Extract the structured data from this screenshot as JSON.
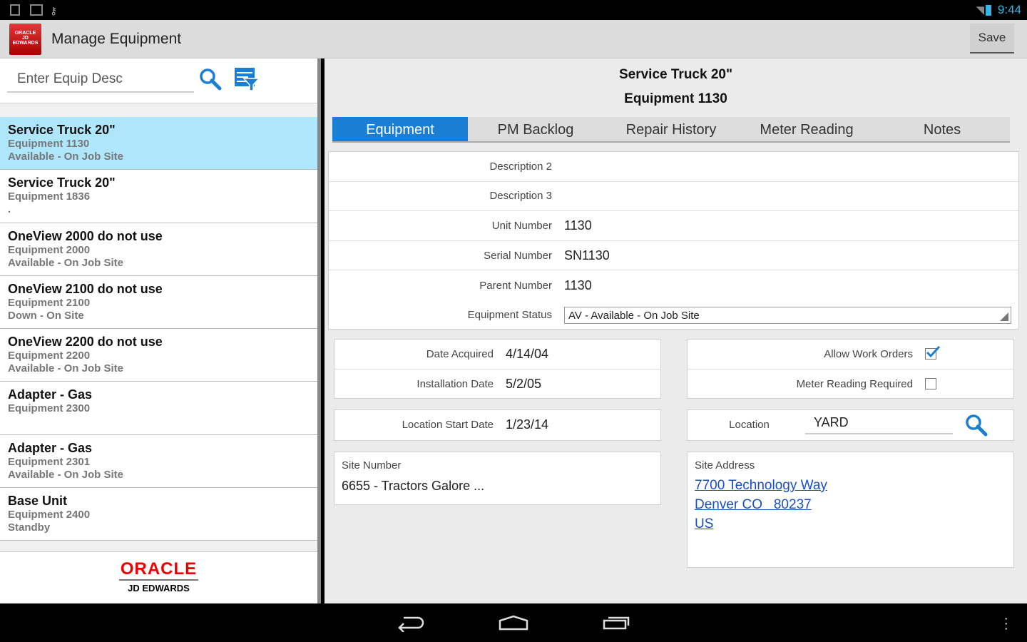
{
  "status": {
    "time": "9:44"
  },
  "app": {
    "title": "Manage Equipment",
    "save_label": "Save",
    "logo_text": "ORACLE"
  },
  "search": {
    "placeholder": "Enter Equip Desc"
  },
  "list": [
    {
      "name": "Service Truck 20\"",
      "sub1": "Equipment 1130",
      "sub2": "Available - On Job Site",
      "selected": true
    },
    {
      "name": "Service Truck 20\"",
      "sub1": "Equipment 1836",
      "sub2": "."
    },
    {
      "name": "OneView 2000 do not use",
      "sub1": "Equipment 2000",
      "sub2": "Available - On Job Site"
    },
    {
      "name": "OneView 2100 do not use",
      "sub1": "Equipment 2100",
      "sub2": "Down - On Site"
    },
    {
      "name": "OneView 2200 do not use",
      "sub1": "Equipment 2200",
      "sub2": "Available - On Job Site"
    },
    {
      "name": "Adapter - Gas",
      "sub1": "Equipment 2300",
      "sub2": ""
    },
    {
      "name": "Adapter - Gas",
      "sub1": "Equipment 2301",
      "sub2": "Available - On Job Site"
    },
    {
      "name": "Base Unit",
      "sub1": "Equipment 2400",
      "sub2": "Standby"
    }
  ],
  "footer": {
    "oracle": "ORACLE",
    "jde": "JD EDWARDS"
  },
  "detail": {
    "title": "Service Truck 20\"",
    "subtitle": "Equipment 1130",
    "tabs": [
      "Equipment",
      "PM Backlog",
      "Repair History",
      "Meter Reading",
      "Notes"
    ],
    "fields": [
      {
        "label": "Description 2",
        "value": ""
      },
      {
        "label": "Description 3",
        "value": ""
      },
      {
        "label": "Unit Number",
        "value": "1130"
      },
      {
        "label": "Serial Number",
        "value": "SN1130"
      },
      {
        "label": "Parent Number",
        "value": "1130"
      }
    ],
    "status_label": "Equipment Status",
    "status_value": "AV - Available - On Job Site",
    "date_acquired_label": "Date Acquired",
    "date_acquired": "4/14/04",
    "install_label": "Installation Date",
    "install": "5/2/05",
    "allow_wo_label": "Allow Work Orders",
    "allow_wo": true,
    "meter_req_label": "Meter Reading Required",
    "meter_req": false,
    "loc_start_label": "Location Start Date",
    "loc_start": "1/23/14",
    "location_label": "Location",
    "location": "YARD",
    "site_number_label": "Site Number",
    "site_number": "6655 - Tractors Galore ...",
    "site_address_label": "Site Address",
    "address": [
      "7700 Technology Way",
      "Denver CO   80237",
      "US"
    ]
  },
  "colors": {
    "accent": "#1a7fd4",
    "selected": "#aee6fb",
    "oracle_red": "#e00000"
  }
}
